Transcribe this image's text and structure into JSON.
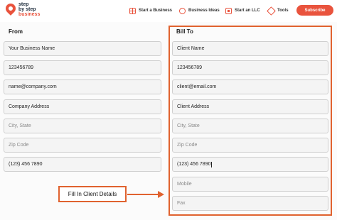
{
  "header": {
    "logo": {
      "line1": "step",
      "line2": "by step",
      "line3": "business"
    },
    "nav": [
      {
        "label": "Start a Business",
        "icon": "grid-icon"
      },
      {
        "label": "Business Ideas",
        "icon": "lightbulb-icon"
      },
      {
        "label": "Start an LLC",
        "icon": "llc-icon"
      },
      {
        "label": "Tools",
        "icon": "tools-icon"
      }
    ],
    "subscribe_label": "Subscribe"
  },
  "from": {
    "title": "From",
    "fields": [
      {
        "value": "Your Business Name"
      },
      {
        "value": "123456789"
      },
      {
        "value": "name@company.com"
      },
      {
        "value": "Company Address"
      },
      {
        "placeholder": "City, State"
      },
      {
        "placeholder": "Zip Code"
      },
      {
        "value": "(123) 456 7890"
      }
    ]
  },
  "bill_to": {
    "title": "Bill To",
    "fields": [
      {
        "value": "Client Name"
      },
      {
        "value": "123456789"
      },
      {
        "value": "client@email.com"
      },
      {
        "value": "Client Address"
      },
      {
        "placeholder": "City, State"
      },
      {
        "placeholder": "Zip Code"
      },
      {
        "value": "(123) 456 7890"
      },
      {
        "placeholder": "Mobile"
      },
      {
        "placeholder": "Fax"
      }
    ]
  },
  "annotation": {
    "text": "Fill In Client Details"
  },
  "colors": {
    "accent": "#e9533d",
    "highlight": "#e0622f"
  }
}
